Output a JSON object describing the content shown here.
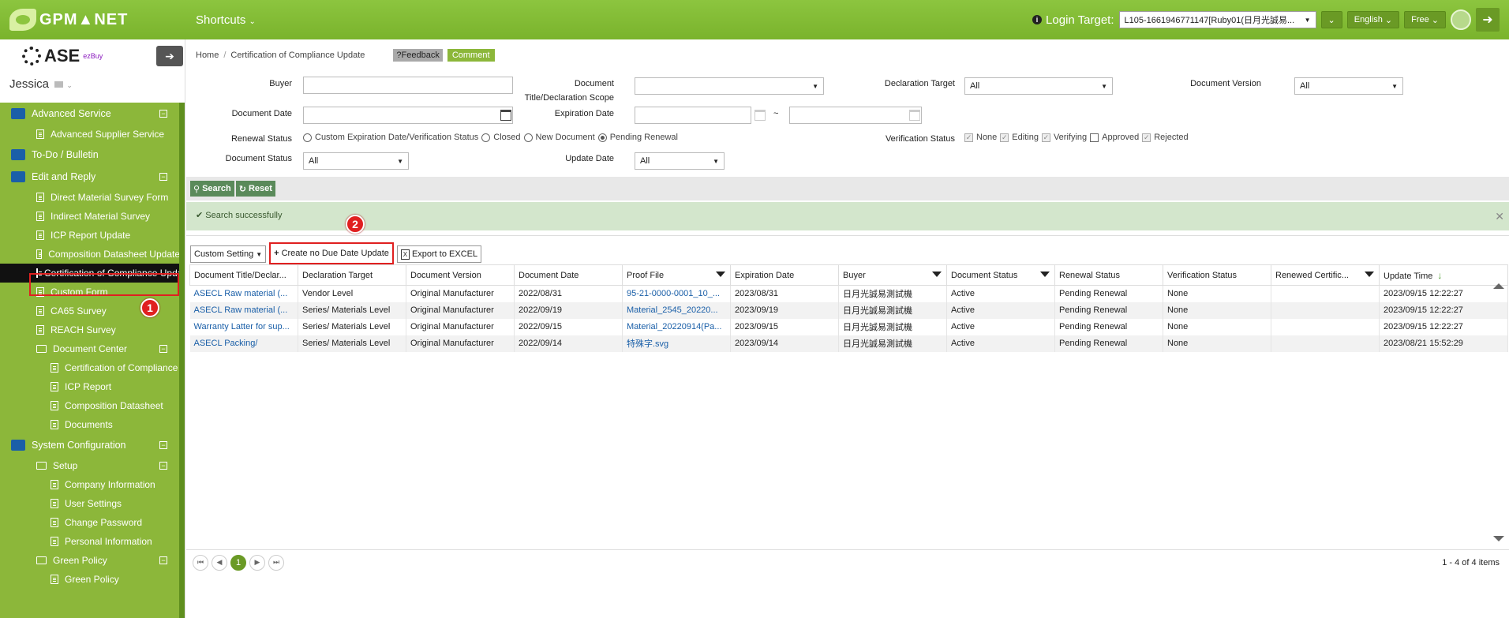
{
  "topbar": {
    "logo": "GPM▲NET",
    "shortcuts": "Shortcuts",
    "login_label": "Login Target:",
    "login_value": "L105-1661946771147[Ruby01(日月光誠易...",
    "language": "English",
    "plan": "Free"
  },
  "sidebar": {
    "company": "ASE",
    "company_sub": "ezBuy",
    "user": "Jessica",
    "menu": [
      {
        "label": "Advanced Service",
        "level": "top",
        "collapsible": true
      },
      {
        "label": "Advanced Supplier Service",
        "level": "1"
      },
      {
        "label": "To-Do / Bulletin",
        "level": "top"
      },
      {
        "label": "Edit and Reply",
        "level": "top",
        "collapsible": true
      },
      {
        "label": "Direct Material Survey Form",
        "level": "1"
      },
      {
        "label": "Indirect Material Survey",
        "level": "1"
      },
      {
        "label": "ICP Report Update",
        "level": "1"
      },
      {
        "label": "Composition Datasheet Update",
        "level": "1"
      },
      {
        "label": "Certification of Compliance Update",
        "level": "1",
        "active": true
      },
      {
        "label": "Custom Form",
        "level": "1"
      },
      {
        "label": "CA65 Survey",
        "level": "1"
      },
      {
        "label": "REACH Survey",
        "level": "1"
      },
      {
        "label": "Document Center",
        "level": "1",
        "folder": true,
        "collapsible": true
      },
      {
        "label": "Certification of Compliance",
        "level": "2"
      },
      {
        "label": "ICP Report",
        "level": "2"
      },
      {
        "label": "Composition Datasheet",
        "level": "2"
      },
      {
        "label": "Documents",
        "level": "2"
      },
      {
        "label": "System Configuration",
        "level": "top",
        "collapsible": true
      },
      {
        "label": "Setup",
        "level": "1",
        "folder": true,
        "collapsible": true
      },
      {
        "label": "Company Information",
        "level": "2"
      },
      {
        "label": "User Settings",
        "level": "2"
      },
      {
        "label": "Change Password",
        "level": "2"
      },
      {
        "label": "Personal Information",
        "level": "2"
      },
      {
        "label": "Green Policy",
        "level": "1",
        "folder": true,
        "collapsible": true
      },
      {
        "label": "Green Policy",
        "level": "2"
      }
    ]
  },
  "breadcrumb": {
    "home": "Home",
    "current": "Certification of Compliance Update",
    "feedback": "?Feedback",
    "comment": "Comment"
  },
  "form": {
    "buyer": "Buyer",
    "document": "Document",
    "document_sub": "Title/Declaration Scope",
    "declaration_target": "Declaration Target",
    "declaration_target_value": "All",
    "document_version": "Document Version",
    "document_version_value": "All",
    "document_date": "Document Date",
    "expiration_date": "Expiration Date",
    "tilde": "~",
    "renewal_status": "Renewal Status",
    "renewal_options": [
      "Custom Expiration Date/Verification Status",
      "Closed",
      "New Document",
      "Pending Renewal"
    ],
    "verification_status": "Verification Status",
    "verification_options": [
      "None",
      "Editing",
      "Verifying",
      "Approved",
      "Rejected"
    ],
    "document_status": "Document Status",
    "document_status_value": "All",
    "update_date": "Update Date",
    "update_date_value": "All"
  },
  "toolbar": {
    "search": "Search",
    "reset": "Reset"
  },
  "message": "Search successfully",
  "grid_toolbar": {
    "custom_setting": "Custom Setting",
    "create": "Create no Due Date Update",
    "export": "Export to EXCEL"
  },
  "grid": {
    "columns": [
      "Document Title/Declar...",
      "Declaration Target",
      "Document Version",
      "Document Date",
      "Proof File",
      "Expiration Date",
      "Buyer",
      "Document Status",
      "Renewal Status",
      "Verification Status",
      "Renewed Certific...",
      "Update Time"
    ],
    "rows": [
      [
        "ASECL Raw material (...",
        "Vendor Level",
        "Original Manufacturer",
        "2022/08/31",
        "95-21-0000-0001_10_...",
        "2023/08/31",
        "日月光誠易測試機",
        "Active",
        "Pending Renewal",
        "None",
        "",
        "2023/09/15 12:22:27"
      ],
      [
        "ASECL Raw material (...",
        "Series/ Materials Level",
        "Original Manufacturer",
        "2022/09/19",
        "Material_2545_20220...",
        "2023/09/19",
        "日月光誠易測試機",
        "Active",
        "Pending Renewal",
        "None",
        "",
        "2023/09/15 12:22:27"
      ],
      [
        "Warranty Latter for sup...",
        "Series/ Materials Level",
        "Original Manufacturer",
        "2022/09/15",
        "Material_20220914(Pa...",
        "2023/09/15",
        "日月光誠易測試機",
        "Active",
        "Pending Renewal",
        "None",
        "",
        "2023/09/15 12:22:27"
      ],
      [
        "ASECL Packing/",
        "Series/ Materials Level",
        "Original Manufacturer",
        "2022/09/14",
        "特殊字.svg",
        "2023/09/14",
        "日月光誠易測試機",
        "Active",
        "Pending Renewal",
        "None",
        "",
        "2023/08/21 15:52:29"
      ]
    ]
  },
  "pager": {
    "current": "1",
    "info": "1 - 4 of 4 items"
  },
  "annotations": [
    "1",
    "2"
  ]
}
